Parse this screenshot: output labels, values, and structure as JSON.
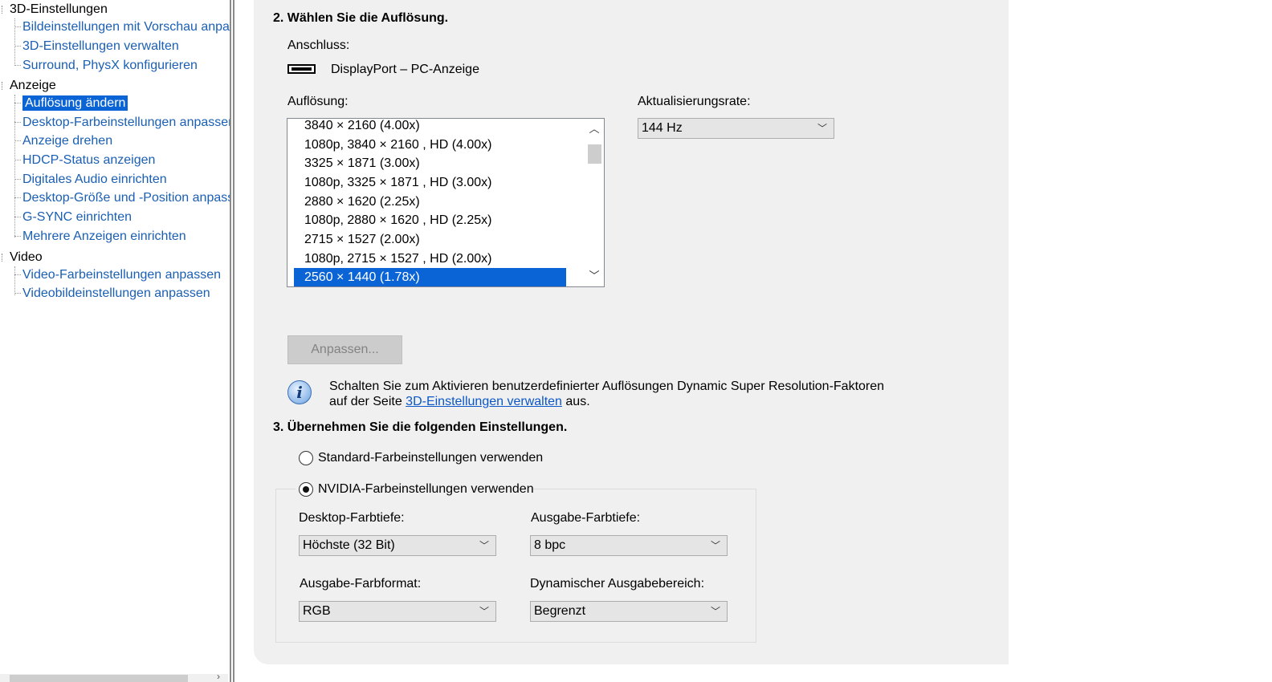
{
  "tree": {
    "categories": [
      {
        "label": "3D-Einstellungen",
        "items": [
          {
            "label": "Bildeinstellungen mit Vorschau anpas",
            "selected": false
          },
          {
            "label": "3D-Einstellungen verwalten",
            "selected": false
          },
          {
            "label": "Surround, PhysX konfigurieren",
            "selected": false
          }
        ]
      },
      {
        "label": "Anzeige",
        "items": [
          {
            "label": "Auflösung ändern",
            "selected": true
          },
          {
            "label": "Desktop-Farbeinstellungen anpassen",
            "selected": false
          },
          {
            "label": "Anzeige drehen",
            "selected": false
          },
          {
            "label": "HDCP-Status anzeigen",
            "selected": false
          },
          {
            "label": "Digitales Audio einrichten",
            "selected": false
          },
          {
            "label": "Desktop-Größe und -Position anpass",
            "selected": false
          },
          {
            "label": "G-SYNC einrichten",
            "selected": false
          },
          {
            "label": "Mehrere Anzeigen einrichten",
            "selected": false
          }
        ]
      },
      {
        "label": "Video",
        "items": [
          {
            "label": "Video-Farbeinstellungen anpassen",
            "selected": false
          },
          {
            "label": "Videobildeinstellungen anpassen",
            "selected": false
          }
        ]
      }
    ]
  },
  "section2": {
    "title": "2. Wählen Sie die Auflösung.",
    "connection_label": "Anschluss:",
    "connection_value": "DisplayPort – PC-Anzeige",
    "resolution_label": "Auflösung:",
    "resolutions": [
      "3840 × 2160 (4.00x)",
      "1080p, 3840 × 2160 , HD (4.00x)",
      "3325 × 1871 (3.00x)",
      "1080p, 3325 × 1871 , HD (3.00x)",
      "2880 × 1620 (2.25x)",
      "1080p, 2880 × 1620 , HD (2.25x)",
      "2715 × 1527 (2.00x)",
      "1080p, 2715 × 1527 , HD (2.00x)",
      "2560 × 1440 (1.78x)"
    ],
    "selected_resolution_index": 8,
    "refresh_label": "Aktualisierungsrate:",
    "refresh_value": "144 Hz",
    "customize_button": "Anpassen...",
    "info_text_before": "Schalten Sie zum Aktivieren benutzerdefinierter Auflösungen Dynamic Super Resolution-Faktoren auf der Seite ",
    "info_link": "3D-Einstellungen verwalten",
    "info_text_after": " aus."
  },
  "section3": {
    "title": "3. Übernehmen Sie die folgenden Einstellungen.",
    "radio_default": "Standard-Farbeinstellungen verwenden",
    "radio_nvidia": "NVIDIA-Farbeinstellungen verwenden",
    "selected_radio": "nvidia",
    "desktop_depth_label": "Desktop-Farbtiefe:",
    "desktop_depth_value": "Höchste (32 Bit)",
    "output_depth_label": "Ausgabe-Farbtiefe:",
    "output_depth_value": "8 bpc",
    "output_format_label": "Ausgabe-Farbformat:",
    "output_format_value": "RGB",
    "dynamic_range_label": "Dynamischer Ausgabebereich:",
    "dynamic_range_value": "Begrenzt"
  },
  "colors": {
    "selection": "#0a64d6",
    "link": "#1a5fb4",
    "panel": "#f0f0f0"
  }
}
